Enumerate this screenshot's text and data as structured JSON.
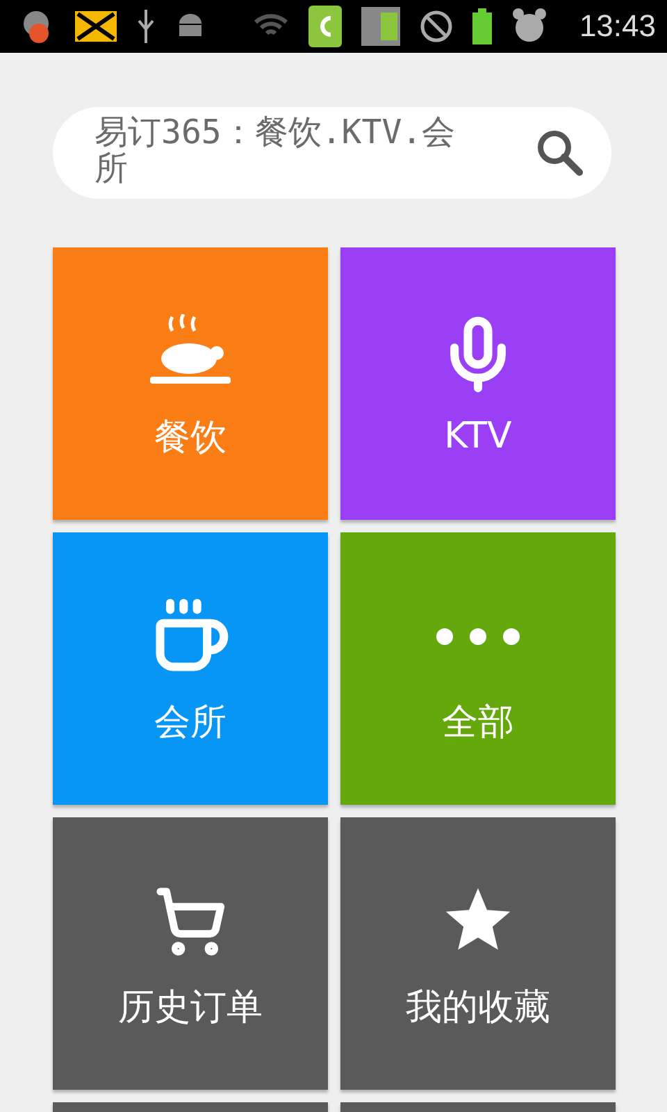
{
  "status_bar": {
    "time": "13:43"
  },
  "search": {
    "placeholder": "易订365：餐饮.KTV.会所"
  },
  "tiles": [
    {
      "label": "餐饮",
      "color": "#fb7d16"
    },
    {
      "label": "KTV",
      "color": "#9a3ff6"
    },
    {
      "label": "会所",
      "color": "#0896f6"
    },
    {
      "label": "全部",
      "color": "#65a80c"
    },
    {
      "label": "历史订单",
      "color": "#5a5a5a"
    },
    {
      "label": "我的收藏",
      "color": "#5a5a5a"
    },
    {
      "color": "#5a5a5a"
    },
    {
      "color": "#5a5a5a"
    }
  ]
}
